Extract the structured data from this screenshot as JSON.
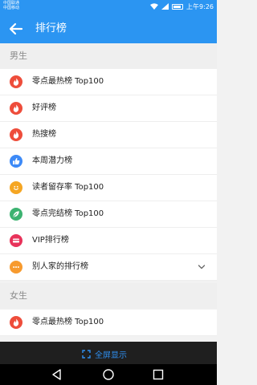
{
  "status_bar": {
    "carrier_1": "中国联通",
    "carrier_2": "中国移动",
    "time": "上午9:26"
  },
  "app_bar": {
    "title": "排行榜",
    "back_icon": "arrow-left-icon"
  },
  "sections": [
    {
      "header": "男生",
      "items": [
        {
          "label": "零点最热榜 Top100",
          "icon": "flame-icon",
          "color": "#ee4d3b"
        },
        {
          "label": "好评榜",
          "icon": "flame-icon",
          "color": "#ee4d3b"
        },
        {
          "label": "热搜榜",
          "icon": "flame-icon",
          "color": "#ee4d3b"
        },
        {
          "label": "本周潜力榜",
          "icon": "thumb-up-icon",
          "color": "#3d8af7"
        },
        {
          "label": "读者留存率 Top100",
          "icon": "smile-icon",
          "color": "#f5a623"
        },
        {
          "label": "零点完结榜 Top100",
          "icon": "leaf-icon",
          "color": "#3cb371"
        },
        {
          "label": "VIP排行榜",
          "icon": "vip-card-icon",
          "color": "#e8335a"
        },
        {
          "label": "别人家的排行榜",
          "icon": "more-dots-icon",
          "color": "#f79a2e",
          "expandable": true
        }
      ]
    },
    {
      "header": "女生",
      "items": [
        {
          "label": "零点最热榜 Top100",
          "icon": "flame-icon",
          "color": "#ee4d3b"
        }
      ]
    }
  ],
  "bottom_bar": {
    "label": "全屏显示",
    "icon": "fullscreen-icon"
  },
  "nav_bar": {
    "back": "triangle-back-icon",
    "home": "circle-home-icon",
    "recents": "square-recents-icon"
  }
}
